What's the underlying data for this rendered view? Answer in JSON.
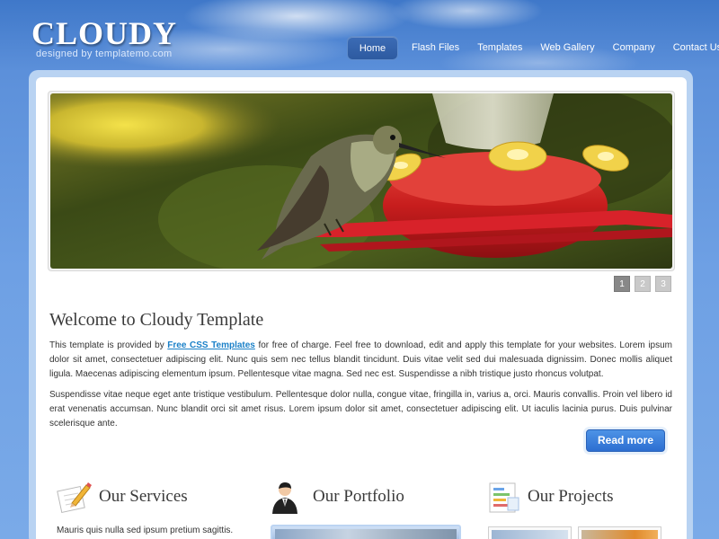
{
  "header": {
    "logo": "CLOUDY",
    "tagline": "designed by templatemo.com"
  },
  "nav": {
    "items": [
      "Home",
      "Flash Files",
      "Templates",
      "Web Gallery",
      "Company",
      "Contact Us"
    ],
    "active": "Home"
  },
  "slider": {
    "pages": [
      "1",
      "2",
      "3"
    ],
    "current": "1"
  },
  "welcome": {
    "title": "Welcome to Cloudy Template",
    "para1_before": "This template is provided by ",
    "para1_link": "Free CSS Templates",
    "para1_after": " for free of charge. Feel free to download, edit and apply this template for your websites. Lorem ipsum dolor sit amet, consectetuer adipiscing elit. Nunc quis sem nec tellus blandit tincidunt. Duis vitae velit sed dui malesuada dignissim. Donec mollis aliquet ligula. Maecenas adipiscing elementum ipsum. Pellentesque vitae magna. Sed nec est. Suspendisse a nibh tristique justo rhoncus volutpat.",
    "para2": "Suspendisse vitae neque eget ante tristique vestibulum. Pellentesque dolor nulla, congue vitae, fringilla in, varius a, orci. Mauris convallis. Proin vel libero id erat venenatis accumsan. Nunc blandit orci sit amet risus. Lorem ipsum dolor sit amet, consectetuer adipiscing elit. Ut iaculis lacinia purus. Duis pulvinar scelerisque ante.",
    "read_more": "Read more"
  },
  "columns": {
    "services": {
      "title": "Our Services",
      "icon": "pencil-paper-icon",
      "text": "Mauris quis nulla sed ipsum pretium sagittis."
    },
    "portfolio": {
      "title": "Our Portfolio",
      "icon": "person-icon"
    },
    "projects": {
      "title": "Our Projects",
      "icon": "chart-document-icon"
    }
  },
  "colors": {
    "background": "#5b8fd8",
    "link": "#1a80c8",
    "button": "#2d6ed1"
  }
}
